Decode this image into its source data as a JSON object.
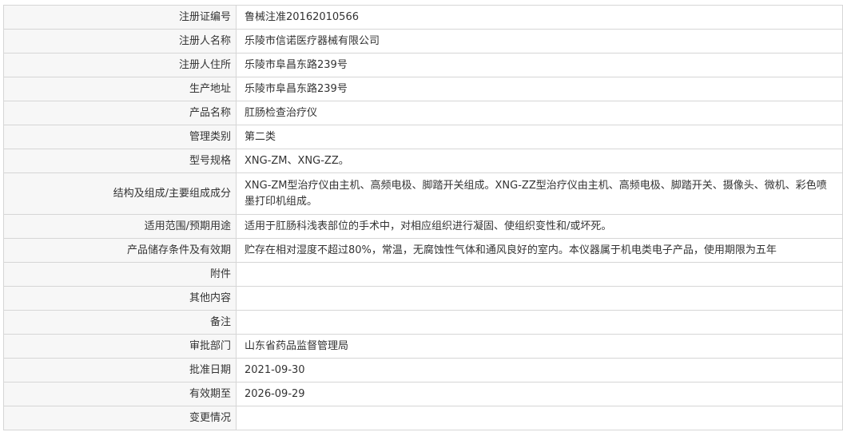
{
  "rows": [
    {
      "label": "注册证编号",
      "value": "鲁械注准20162010566"
    },
    {
      "label": "注册人名称",
      "value": "乐陵市信诺医疗器械有限公司"
    },
    {
      "label": "注册人住所",
      "value": "乐陵市阜昌东路239号"
    },
    {
      "label": "生产地址",
      "value": "乐陵市阜昌东路239号"
    },
    {
      "label": "产品名称",
      "value": "肛肠检查治疗仪"
    },
    {
      "label": "管理类别",
      "value": "第二类"
    },
    {
      "label": "型号规格",
      "value": "XNG-ZM、XNG-ZZ。"
    },
    {
      "label": "结构及组成/主要组成成分",
      "value": "XNG-ZM型治疗仪由主机、高频电极、脚踏开关组成。XNG-ZZ型治疗仪由主机、高频电极、脚踏开关、摄像头、微机、彩色喷墨打印机组成。"
    },
    {
      "label": "适用范围/预期用途",
      "value": "适用于肛肠科浅表部位的手术中，对相应组织进行凝固、使组织变性和/或坏死。"
    },
    {
      "label": "产品储存条件及有效期",
      "value": "贮存在相对湿度不超过80%，常温，无腐蚀性气体和通风良好的室内。本仪器属于机电类电子产品，使用期限为五年"
    },
    {
      "label": "附件",
      "value": ""
    },
    {
      "label": "其他内容",
      "value": ""
    },
    {
      "label": "备注",
      "value": ""
    },
    {
      "label": "审批部门",
      "value": "山东省药品监督管理局"
    },
    {
      "label": "批准日期",
      "value": "2021-09-30"
    },
    {
      "label": "有效期至",
      "value": "2026-09-29"
    },
    {
      "label": "变更情况",
      "value": ""
    }
  ]
}
